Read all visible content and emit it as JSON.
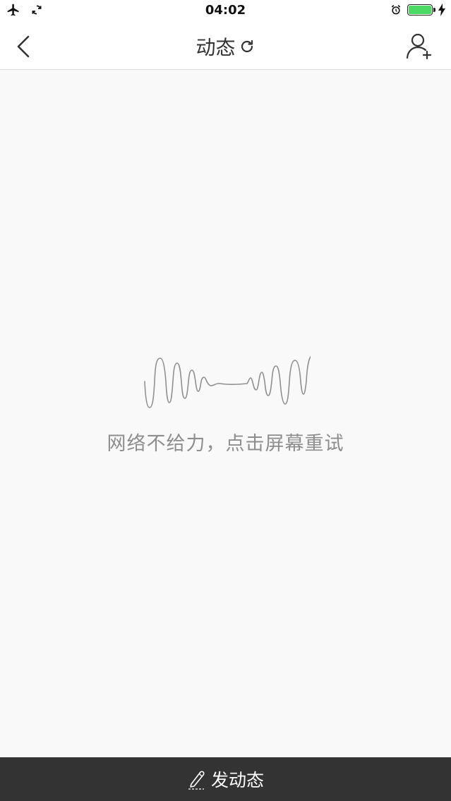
{
  "status_bar": {
    "time": "04:02",
    "left_icons": [
      "airplane-icon",
      "sync-icon"
    ],
    "right_icons": [
      "alarm-icon",
      "battery-icon",
      "charging-icon"
    ],
    "battery_level": 1.0,
    "battery_color": "#4cd964"
  },
  "nav": {
    "title": "动态",
    "back_icon": "chevron-left-icon",
    "refresh_icon": "refresh-icon",
    "add_friend_icon": "add-user-icon"
  },
  "main": {
    "error_message": "网络不给力，点击屏幕重试",
    "illustration_icon": "sound-wave-icon"
  },
  "bottom_bar": {
    "post_label": "发动态",
    "post_icon": "pencil-icon",
    "background": "#333333"
  }
}
